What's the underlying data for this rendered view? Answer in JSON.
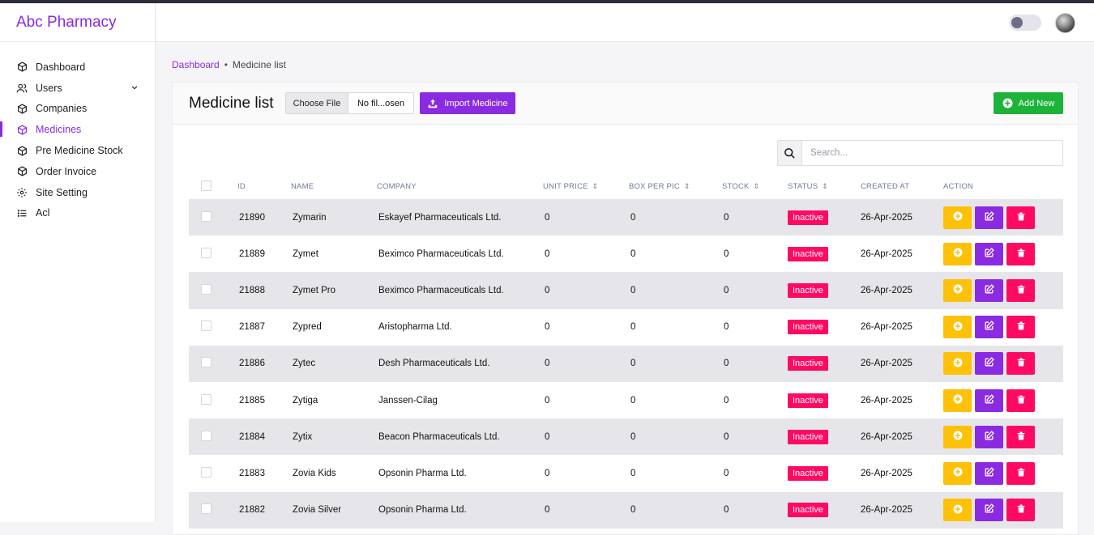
{
  "app": {
    "title": "Abc Pharmacy"
  },
  "sidebar": {
    "items": [
      {
        "label": "Dashboard",
        "icon": "cube-icon"
      },
      {
        "label": "Users",
        "icon": "users-icon"
      },
      {
        "label": "Companies",
        "icon": "cube-icon"
      },
      {
        "label": "Medicines",
        "icon": "cube-icon"
      },
      {
        "label": "Pre Medicine Stock",
        "icon": "cube-icon"
      },
      {
        "label": "Order Invoice",
        "icon": "cube-icon"
      },
      {
        "label": "Site Setting",
        "icon": "gear-icon"
      },
      {
        "label": "Acl",
        "icon": "list-icon"
      }
    ]
  },
  "breadcrumb": {
    "home": "Dashboard",
    "separator": "•",
    "current": "Medicine list"
  },
  "page": {
    "title": "Medicine list",
    "file_button": "Choose File",
    "file_name": "No fil...osen",
    "import_label": "Import Medicine",
    "add_label": "Add New",
    "search_placeholder": "Search..."
  },
  "table": {
    "headers": [
      "ID",
      "NAME",
      "COMPANY",
      "UNIT PRICE",
      "BOX PER PIC",
      "STOCK",
      "STATUS",
      "CREATED AT",
      "ACTION"
    ],
    "rows": [
      [
        "21890",
        "Zymarin",
        "Eskayef Pharmaceuticals Ltd.",
        "0",
        "0",
        "0",
        "Inactive",
        "26-Apr-2025"
      ],
      [
        "21889",
        "Zymet",
        "Beximco Pharmaceuticals Ltd.",
        "0",
        "0",
        "0",
        "Inactive",
        "26-Apr-2025"
      ],
      [
        "21888",
        "Zymet Pro",
        "Beximco Pharmaceuticals Ltd.",
        "0",
        "0",
        "0",
        "Inactive",
        "26-Apr-2025"
      ],
      [
        "21887",
        "Zypred",
        "Aristopharma Ltd.",
        "0",
        "0",
        "0",
        "Inactive",
        "26-Apr-2025"
      ],
      [
        "21886",
        "Zytec",
        "Desh Pharmaceuticals Ltd.",
        "0",
        "0",
        "0",
        "Inactive",
        "26-Apr-2025"
      ],
      [
        "21885",
        "Zytiga",
        "Janssen-Cilag",
        "0",
        "0",
        "0",
        "Inactive",
        "26-Apr-2025"
      ],
      [
        "21884",
        "Zytix",
        "Beacon Pharmaceuticals Ltd.",
        "0",
        "0",
        "0",
        "Inactive",
        "26-Apr-2025"
      ],
      [
        "21883",
        "Zovia Kids",
        "Opsonin Pharma Ltd.",
        "0",
        "0",
        "0",
        "Inactive",
        "26-Apr-2025"
      ],
      [
        "21882",
        "Zovia Silver",
        "Opsonin Pharma Ltd.",
        "0",
        "0",
        "0",
        "Inactive",
        "26-Apr-2025"
      ]
    ]
  },
  "colors": {
    "accent": "#8a2be2",
    "success": "#1db33b",
    "danger": "#fe0a62",
    "warning": "#fdc108"
  }
}
